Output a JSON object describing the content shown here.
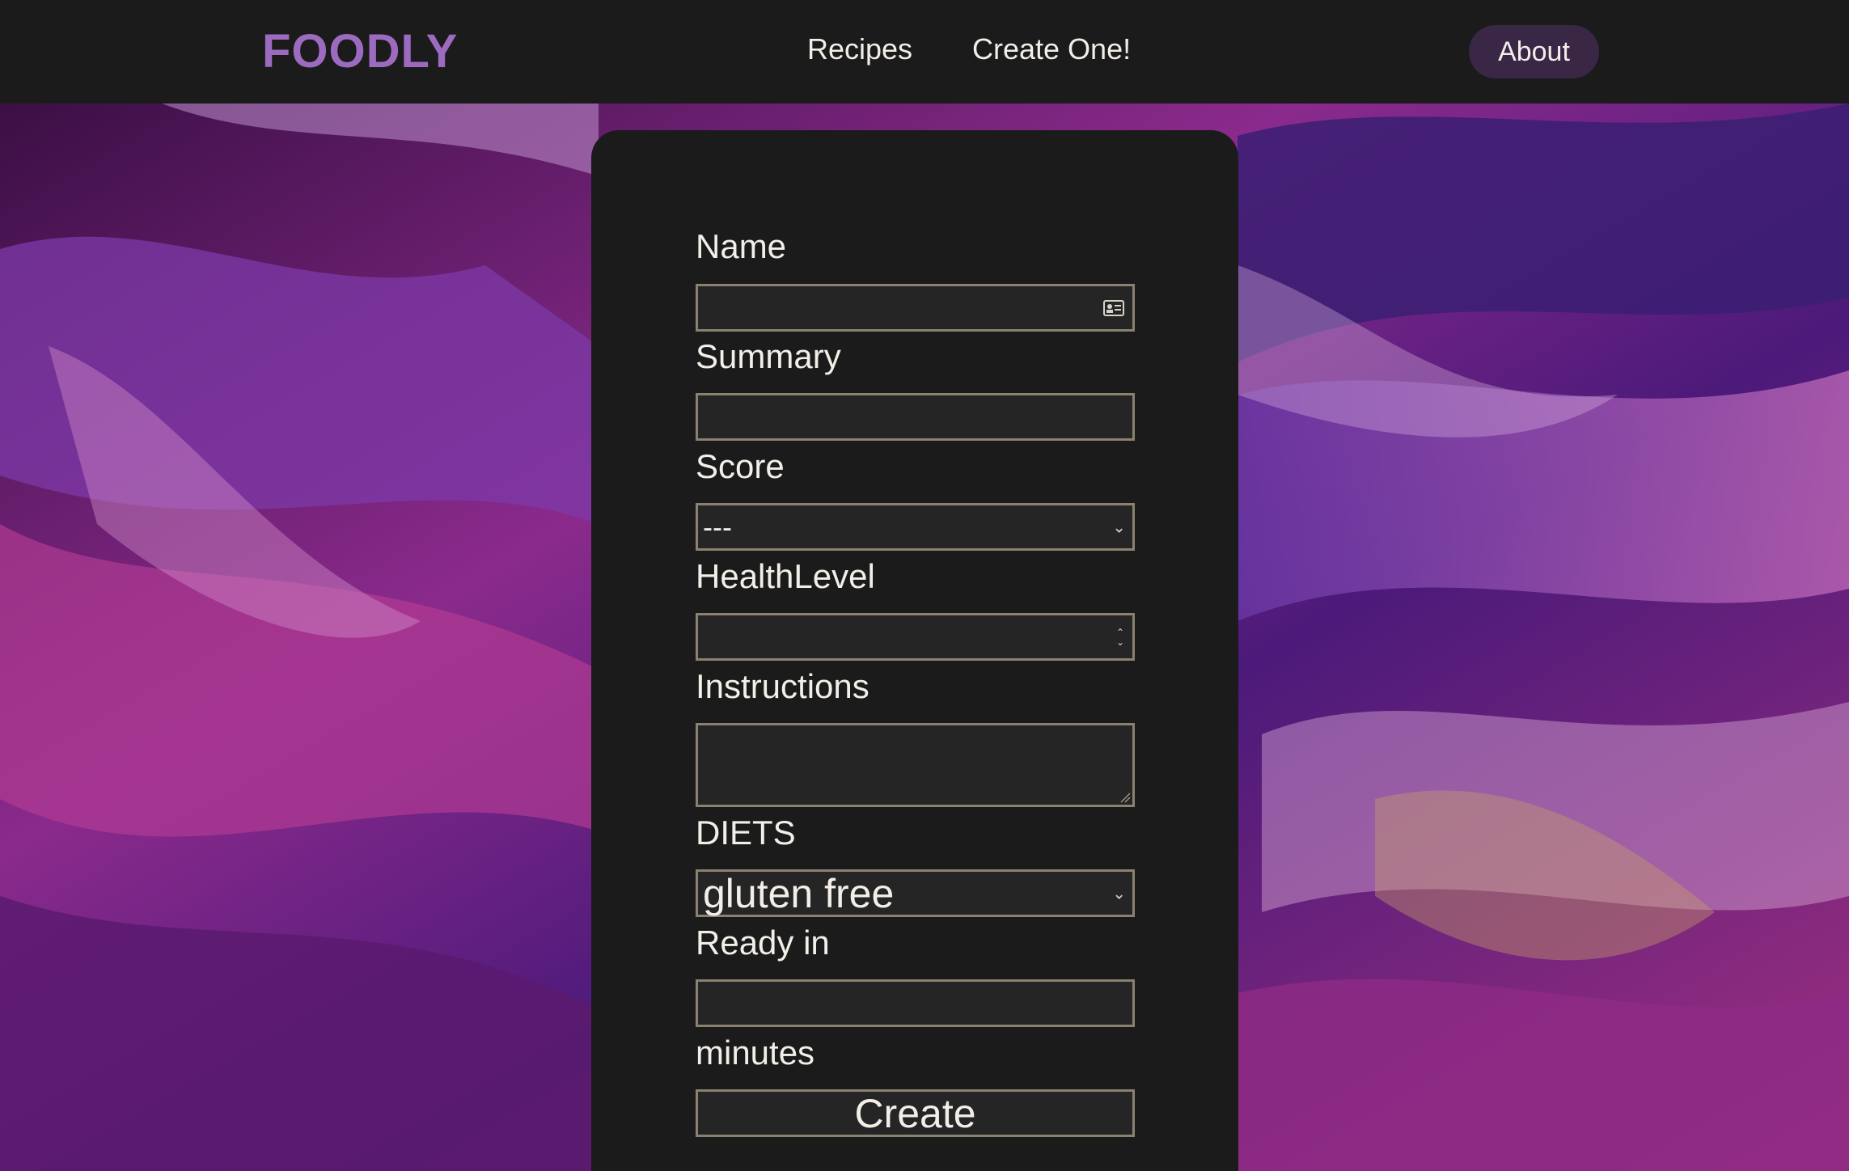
{
  "nav": {
    "logo": "FOODLY",
    "links": [
      "Recipes",
      "Create One!"
    ],
    "about": "About"
  },
  "form": {
    "name_label": "Name",
    "summary_label": "Summary",
    "score_label": "Score",
    "score_value": "---",
    "health_label": "HealthLevel",
    "instructions_label": "Instructions",
    "diets_label": "DIETS",
    "diets_value": "gluten free",
    "ready_label": "Ready in",
    "minutes_label": "minutes",
    "submit": "Create"
  },
  "colors": {
    "logo": "#9c6bbf",
    "about_bg": "#3a2645",
    "card_bg": "#1b1b1b",
    "input_border": "#8a8170"
  }
}
